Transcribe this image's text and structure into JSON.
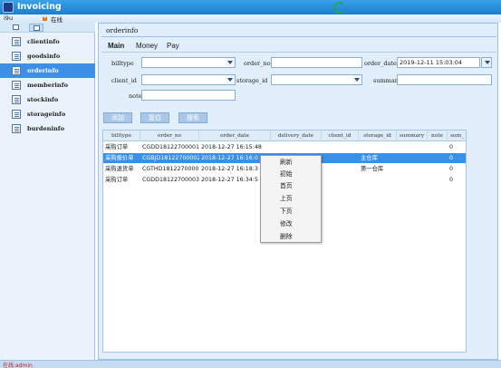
{
  "app": {
    "title": "Invoicing"
  },
  "menubar": {
    "user": "i9u",
    "status": "在线"
  },
  "sidebar": {
    "items": [
      {
        "label": "clientinfo",
        "active": false
      },
      {
        "label": "goodsinfo",
        "active": false
      },
      {
        "label": "orderinfo",
        "active": true
      },
      {
        "label": "memberinfo",
        "active": false
      },
      {
        "label": "stockinfo",
        "active": false
      },
      {
        "label": "storageinfo",
        "active": false
      },
      {
        "label": "burdeninfo",
        "active": false
      }
    ]
  },
  "main": {
    "title": "orderinfo",
    "tabs": [
      "Main",
      "Money",
      "Pay"
    ],
    "form": {
      "billtype_label": "billtype",
      "billtype_value": "",
      "order_no_label": "order_no",
      "order_no_value": "",
      "order_date_label": "order_date",
      "order_date_value": "2019-12-11 15:03:04",
      "client_id_label": "client_id",
      "client_id_value": "",
      "storage_id_label": "storage_id",
      "storage_id_value": "",
      "summary_label": "summary",
      "summary_value": "",
      "note_label": "note",
      "note_value": ""
    },
    "buttons": {
      "add": "添加",
      "reset": "复位",
      "search": "搜索"
    }
  },
  "table": {
    "columns": [
      "billtype",
      "order_no",
      "order_date",
      "delivery_date",
      "client_id",
      "storage_id",
      "summary",
      "note",
      "sum_"
    ],
    "rows": [
      {
        "billtype": "采购订单",
        "order_no": "CGDD18122700001",
        "order_date": "2018-12-27 16:15:48",
        "delivery_date": "",
        "client_id": "",
        "storage_id": "",
        "summary": "",
        "note": "",
        "sum": "0",
        "selected": false
      },
      {
        "billtype": "采购报价单",
        "order_no": "CGBJD18122700002",
        "order_date": "2018-12-27 16:16:0",
        "delivery_date": "",
        "client_id": "",
        "storage_id": "主仓库",
        "summary": "",
        "note": "",
        "sum": "0",
        "selected": true
      },
      {
        "billtype": "采购退货单",
        "order_no": "CGTHD18122700002",
        "order_date": "2018-12-27 16:18:3",
        "delivery_date": "",
        "client_id": "",
        "storage_id": "第一仓库",
        "summary": "",
        "note": "",
        "sum": "0",
        "selected": false
      },
      {
        "billtype": "采购订单",
        "order_no": "CGDD18122700003",
        "order_date": "2018-12-27 16:34:5",
        "delivery_date": "",
        "client_id": "",
        "storage_id": "",
        "summary": "",
        "note": "",
        "sum": "0",
        "selected": false
      }
    ]
  },
  "context_menu": {
    "items": [
      "刷新",
      "初始",
      "首页",
      "上页",
      "下页",
      "修改",
      "删除"
    ]
  },
  "statusbar": {
    "text": "在线:admin"
  }
}
